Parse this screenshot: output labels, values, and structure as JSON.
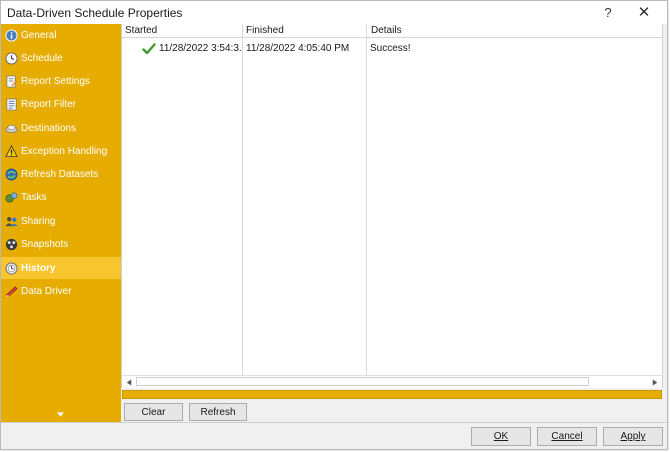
{
  "window": {
    "title": "Data-Driven Schedule Properties",
    "help_label": "?",
    "close_label": "✕"
  },
  "sidebar": {
    "items": [
      {
        "label": "General",
        "icon": "info-icon"
      },
      {
        "label": "Schedule",
        "icon": "clock-icon"
      },
      {
        "label": "Report Settings",
        "icon": "report-settings-icon"
      },
      {
        "label": "Report Filter",
        "icon": "report-filter-icon"
      },
      {
        "label": "Destinations",
        "icon": "destinations-icon"
      },
      {
        "label": "Exception Handling",
        "icon": "warning-icon"
      },
      {
        "label": "Refresh Datasets",
        "icon": "refresh-datasets-icon"
      },
      {
        "label": "Tasks",
        "icon": "tasks-icon"
      },
      {
        "label": "Sharing",
        "icon": "sharing-icon"
      },
      {
        "label": "Snapshots",
        "icon": "snapshots-icon"
      },
      {
        "label": "History",
        "icon": "history-icon",
        "active": true
      },
      {
        "label": "Data Driver",
        "icon": "data-driver-icon"
      }
    ],
    "expand_icon": "chevron-down-icon",
    "accent_color": "#e6ad00",
    "active_color": "#f7c52e"
  },
  "history_grid": {
    "columns": [
      "Started",
      "Finished",
      "Details"
    ],
    "rows": [
      {
        "status_icon": "check-icon",
        "started": "11/28/2022 3:54:3...",
        "finished": "11/28/2022 4:05:40 PM",
        "details": "Success!"
      }
    ]
  },
  "actions": {
    "clear_label": "Clear",
    "refresh_label": "Refresh"
  },
  "footer": {
    "ok_label": "OK",
    "cancel_label": "Cancel",
    "apply_label": "Apply"
  }
}
